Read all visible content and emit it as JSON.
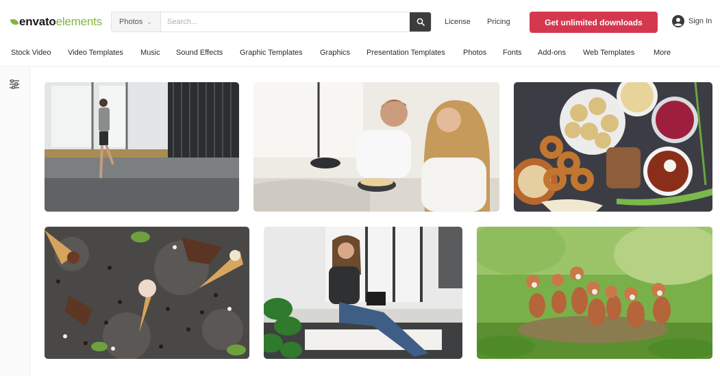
{
  "brand": {
    "logo_prefix": "envato",
    "logo_suffix": "elements",
    "accent": "#82b541",
    "cta_color": "#d5374f"
  },
  "search": {
    "category": "Photos",
    "placeholder": "Search...",
    "value": ""
  },
  "header": {
    "license": "License",
    "pricing": "Pricing",
    "cta": "Get unlimited downloads",
    "sign_in": "Sign In"
  },
  "categories": [
    "Stock Video",
    "Video Templates",
    "Music",
    "Sound Effects",
    "Graphic Templates",
    "Graphics",
    "Presentation Templates",
    "Photos",
    "Fonts",
    "Add-ons",
    "Web Templates",
    "More"
  ],
  "icons": {
    "filter": "sliders-icon",
    "search": "search-icon",
    "user": "user-circle-icon",
    "dropdown": "chevron-down-icon"
  },
  "photos": [
    {
      "subject": "man-stretching-gym",
      "dominant": "#9da2a2"
    },
    {
      "subject": "couple-in-bed-laughing",
      "dominant": "#e8e3dc"
    },
    {
      "subject": "food-spread-bagels",
      "dominant": "#3f4046"
    },
    {
      "subject": "ice-cream-cones-chocolate",
      "dominant": "#484644"
    },
    {
      "subject": "woman-reading-tablet",
      "dominant": "#c7c6c2"
    },
    {
      "subject": "fox-cubs-grass",
      "dominant": "#6fa043"
    }
  ]
}
